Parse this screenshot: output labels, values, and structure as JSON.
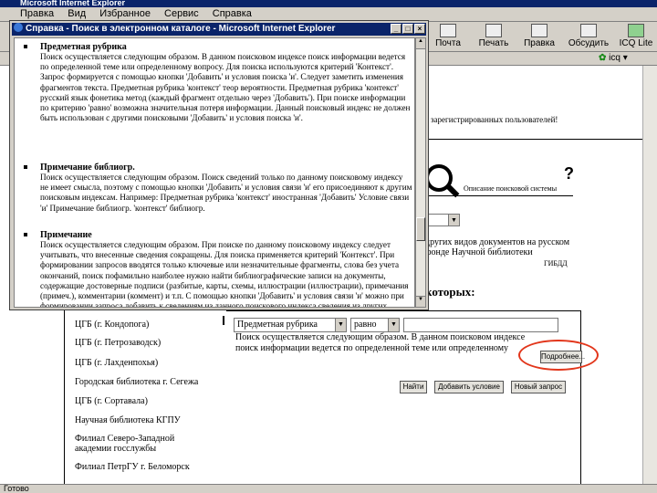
{
  "browser": {
    "title": "Microsoft Internet Explorer",
    "menu": [
      "Правка",
      "Вид",
      "Избранное",
      "Сервис",
      "Справка"
    ],
    "toolbar": [
      {
        "label": "Почта",
        "icon": "mail-icon"
      },
      {
        "label": "Печать",
        "icon": "print-icon"
      },
      {
        "label": "Правка",
        "icon": "edit-icon"
      },
      {
        "label": "Обсудить",
        "icon": "discuss-icon"
      },
      {
        "label": "ICQ Lite",
        "icon": "icq-icon"
      }
    ],
    "icq_label": "icq",
    "status": "Готово"
  },
  "page": {
    "header_text": "зарегистрированных пользователей!",
    "search_caption": "Описание поисковой системы",
    "question_mark": "?",
    "intro_line1": "других видов документов на русском",
    "intro_line2": "фонде Научной библиотеки",
    "intro_line3": "ГИБДД",
    "which_label": "которых:",
    "libraries": [
      "ЦГБ (г. Кондопога)",
      "ЦГБ (г. Петрозаводск)",
      "ЦГБ (г. Лахденпохья)",
      "Городская библиотека г. Сегежа",
      "ЦГБ (г. Сортавала)",
      "Научная библиотека КГПУ",
      "Филиал Северо-Западной академии госслужбы",
      "Филиал ПетрГУ г. Беломорск"
    ],
    "search_field_select": "Предметная рубрика",
    "condition_select": "равно",
    "field_description": "Поиск осуществляется следующим образом. В данном поисковом индексе поиск информации ведется по определенной теме или определенному",
    "buttons": {
      "more": "Подробнее...",
      "find": "Найти",
      "add_condition": "Добавить условие",
      "new_query": "Новый запрос"
    }
  },
  "popup": {
    "title": "Справка - Поиск в электронном каталоге - Microsoft Internet Explorer",
    "sections": [
      {
        "heading": "Предметная рубрика",
        "body": "Поиск осуществляется следующим образом. В данном поисковом индексе поиск информации ведется по определенной теме или определенному вопросу. Для поиска используются критерий 'Контекст'. Запрос формируется с помощью кнопки 'Добавить' и условия поиска 'и'. Следует заметить изменения фрагментов текста. Предметная рубрика 'контекст' теор вероятности. Предметная рубрика 'контекст' русский язык фонетика метод (каждый фрагмент отдельно через 'Добавить'). При поиске информации по критерию 'равно' возможна значительная потеря информации. Данный поисковый индекс не должен быть использован с другими поисковыми 'Добавить' и условия поиска 'и'."
      },
      {
        "heading": "Примечание библиогр.",
        "body": "Поиск осуществляется следующим образом. Поиск сведений только по данному поисковому индексу не имеет смысла, поэтому с помощью кнопки 'Добавить' и условия связи 'и' его присоединяют к другим поисковым индексам. Например: Предметная рубрика 'контекст' иностранная 'Добавить' Условие связи 'и' Примечание библиогр. 'контекст' библиогр."
      },
      {
        "heading": "Примечание",
        "body": "Поиск осуществляется следующим образом. При поиске по данному поисковому индексу следует учитывать, что внесенные сведения сокращены. Для поиска применяется критерий 'Контекст'. При формировании запросов вводятся только ключевые или незначительные фрагменты, слова без учета окончаний, поиск пофамильно наиболее нужно найти библиографические записи на документы, содержащие достоверные подписи (разбитые, карты, схемы, иллюстрации (иллюстрации), примечания (примеч.), комментарии (коммент) и т.п. С помощью кнопки 'Добавить' и условия связи 'и' можно при формировании запроса добавить к сведениям из данного поискового индекса сведения из других поисковых индексов."
      }
    ]
  }
}
